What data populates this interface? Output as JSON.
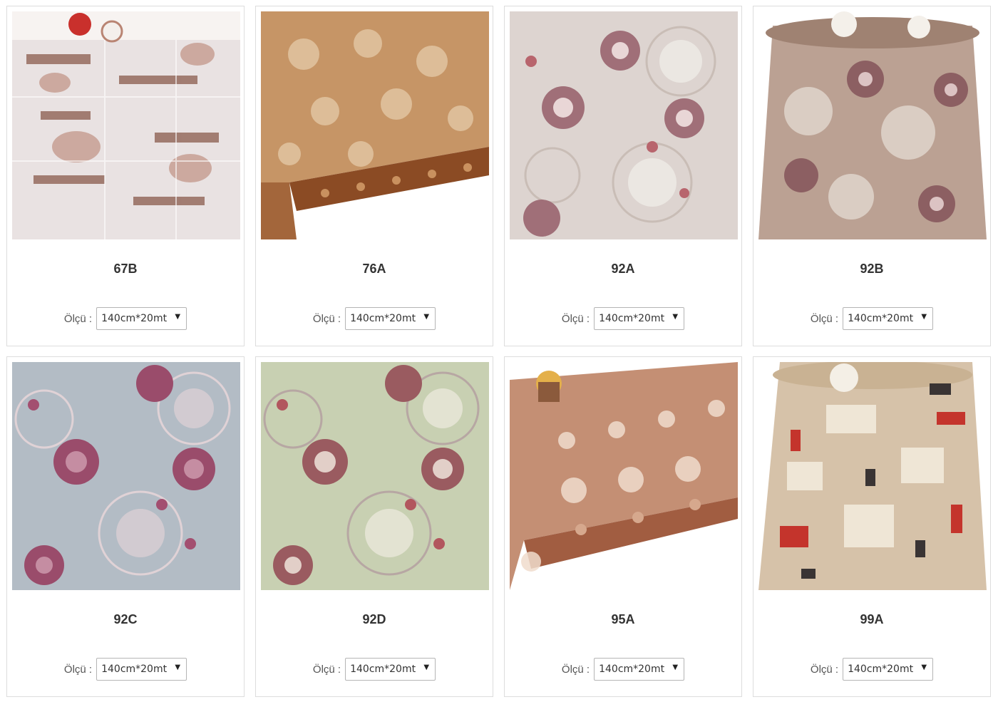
{
  "size_label": "Ölçü :",
  "products": [
    {
      "code": "67B",
      "size": "140cm*20mt",
      "palette": [
        "#e9e2e2",
        "#8a5b4c",
        "#f4efec",
        "#b98473"
      ]
    },
    {
      "code": "76A",
      "size": "140cm*20mt",
      "palette": [
        "#c69566",
        "#8b4b24",
        "#e7cfae",
        "#a3663b"
      ]
    },
    {
      "code": "92A",
      "size": "140cm*20mt",
      "palette": [
        "#ddd4d0",
        "#a06f78",
        "#ebe7e2",
        "#c9bdb6"
      ]
    },
    {
      "code": "92B",
      "size": "140cm*20mt",
      "palette": [
        "#bba193",
        "#8c5f62",
        "#e2d8d0",
        "#9f8272"
      ]
    },
    {
      "code": "92C",
      "size": "140cm*20mt",
      "palette": [
        "#b3bcc5",
        "#9a4c6b",
        "#e0d2d6",
        "#c58da2"
      ]
    },
    {
      "code": "92D",
      "size": "140cm*20mt",
      "palette": [
        "#c8d0b2",
        "#9a5b60",
        "#eae7da",
        "#b7a7a3"
      ]
    },
    {
      "code": "95A",
      "size": "140cm*20mt",
      "palette": [
        "#c48f74",
        "#a15d41",
        "#f0dccd",
        "#d6a88d"
      ]
    },
    {
      "code": "99A",
      "size": "140cm*20mt",
      "palette": [
        "#d6c2a9",
        "#3a3434",
        "#efe6d6",
        "#c4342c"
      ]
    }
  ]
}
